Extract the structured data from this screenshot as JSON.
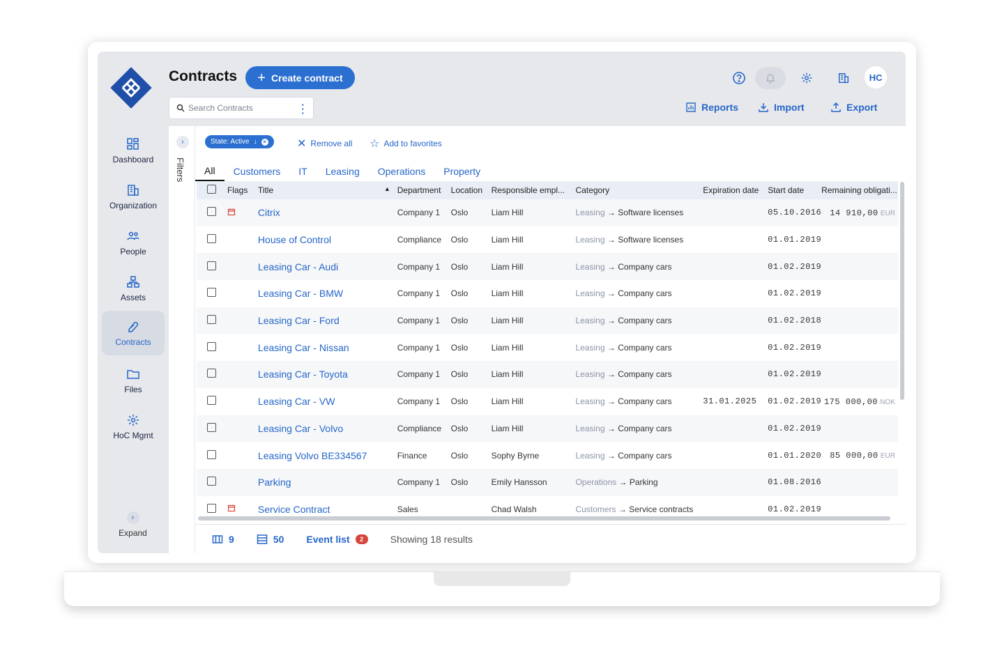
{
  "header": {
    "title": "Contracts",
    "create_label": "Create contract",
    "search_placeholder": "Search Contracts",
    "avatar_initials": "HC",
    "actions": {
      "reports": "Reports",
      "import": "Import",
      "export": "Export"
    }
  },
  "sidebar": {
    "items": [
      {
        "label": "Dashboard",
        "icon": "dashboard-icon"
      },
      {
        "label": "Organization",
        "icon": "building-icon"
      },
      {
        "label": "People",
        "icon": "people-icon"
      },
      {
        "label": "Assets",
        "icon": "assets-icon"
      },
      {
        "label": "Contracts",
        "icon": "contracts-icon",
        "active": true
      },
      {
        "label": "Files",
        "icon": "folder-icon"
      },
      {
        "label": "HoC Mgmt",
        "icon": "gear-icon"
      }
    ],
    "expand_label": "Expand"
  },
  "filters": {
    "label": "Filters",
    "chip": "State: Active",
    "remove_all": "Remove all",
    "add_favorites": "Add to favorites"
  },
  "tabs": [
    "All",
    "Customers",
    "IT",
    "Leasing",
    "Operations",
    "Property"
  ],
  "table": {
    "columns": [
      "Flags",
      "Title",
      "Department",
      "Location",
      "Responsible empl...",
      "Category",
      "Expiration date",
      "Start date",
      "Remaining obligati..."
    ],
    "rows": [
      {
        "flag": true,
        "title": "Citrix",
        "dept": "Company 1",
        "loc": "Oslo",
        "resp": "Liam Hill",
        "cat_main": "Leasing",
        "cat_sub": "Software licenses",
        "exp": "",
        "start": "05.10.2016",
        "rem": "14 910,00",
        "cur": "EUR"
      },
      {
        "flag": false,
        "title": "House of Control",
        "dept": "Compliance",
        "loc": "Oslo",
        "resp": "Liam Hill",
        "cat_main": "Leasing",
        "cat_sub": "Software licenses",
        "exp": "",
        "start": "01.01.2019",
        "rem": "",
        "cur": ""
      },
      {
        "flag": false,
        "title": "Leasing Car - Audi",
        "dept": "Company 1",
        "loc": "Oslo",
        "resp": "Liam Hill",
        "cat_main": "Leasing",
        "cat_sub": "Company cars",
        "exp": "",
        "start": "01.02.2019",
        "rem": "",
        "cur": ""
      },
      {
        "flag": false,
        "title": "Leasing Car - BMW",
        "dept": "Company 1",
        "loc": "Oslo",
        "resp": "Liam Hill",
        "cat_main": "Leasing",
        "cat_sub": "Company cars",
        "exp": "",
        "start": "01.02.2019",
        "rem": "",
        "cur": ""
      },
      {
        "flag": false,
        "title": "Leasing Car - Ford",
        "dept": "Company 1",
        "loc": "Oslo",
        "resp": "Liam Hill",
        "cat_main": "Leasing",
        "cat_sub": "Company cars",
        "exp": "",
        "start": "01.02.2018",
        "rem": "",
        "cur": ""
      },
      {
        "flag": false,
        "title": "Leasing Car - Nissan",
        "dept": "Company 1",
        "loc": "Oslo",
        "resp": "Liam Hill",
        "cat_main": "Leasing",
        "cat_sub": "Company cars",
        "exp": "",
        "start": "01.02.2019",
        "rem": "",
        "cur": ""
      },
      {
        "flag": false,
        "title": "Leasing Car - Toyota",
        "dept": "Company 1",
        "loc": "Oslo",
        "resp": "Liam Hill",
        "cat_main": "Leasing",
        "cat_sub": "Company cars",
        "exp": "",
        "start": "01.02.2019",
        "rem": "",
        "cur": ""
      },
      {
        "flag": false,
        "title": "Leasing Car - VW",
        "dept": "Company 1",
        "loc": "Oslo",
        "resp": "Liam Hill",
        "cat_main": "Leasing",
        "cat_sub": "Company cars",
        "exp": "31.01.2025",
        "start": "01.02.2019",
        "rem": "175 000,00",
        "cur": "NOK"
      },
      {
        "flag": false,
        "title": "Leasing Car - Volvo",
        "dept": "Compliance",
        "loc": "Oslo",
        "resp": "Liam Hill",
        "cat_main": "Leasing",
        "cat_sub": "Company cars",
        "exp": "",
        "start": "01.02.2019",
        "rem": "",
        "cur": ""
      },
      {
        "flag": false,
        "title": "Leasing Volvo BE334567",
        "dept": "Finance",
        "loc": "Oslo",
        "resp": "Sophy Byrne",
        "cat_main": "Leasing",
        "cat_sub": "Company cars",
        "exp": "",
        "start": "01.01.2020",
        "rem": "85 000,00",
        "cur": "EUR"
      },
      {
        "flag": false,
        "title": "Parking",
        "dept": "Company 1",
        "loc": "Oslo",
        "resp": "Emily Hansson",
        "cat_main": "Operations",
        "cat_sub": "Parking",
        "exp": "",
        "start": "01.08.2016",
        "rem": "",
        "cur": ""
      },
      {
        "flag": true,
        "title": "Service Contract",
        "dept": "Sales",
        "loc": "",
        "resp": "Chad Walsh",
        "cat_main": "Customers",
        "cat_sub": "Service contracts",
        "exp": "",
        "start": "01.02.2019",
        "rem": "",
        "cur": ""
      }
    ]
  },
  "footer": {
    "columns_count": "9",
    "page_size": "50",
    "event_list": "Event list",
    "event_badge": "2",
    "results": "Showing 18 results"
  },
  "colors": {
    "accent": "#2b6fd0",
    "badge": "#d6443b",
    "sidebar_bg": "#e6e8ec"
  }
}
